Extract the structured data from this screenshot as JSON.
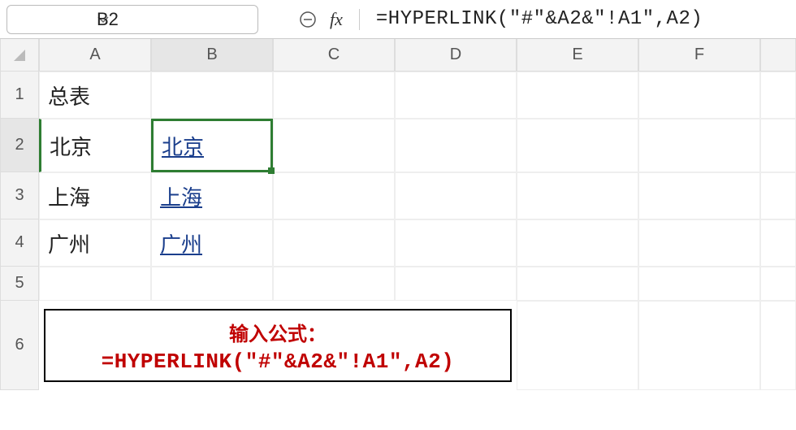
{
  "name_box": {
    "reference": "B2"
  },
  "formula_bar": {
    "formula": "=HYPERLINK(\"#\"&A2&\"!A1\",A2)"
  },
  "columns": [
    "A",
    "B",
    "C",
    "D",
    "E",
    "F"
  ],
  "rows": [
    "1",
    "2",
    "3",
    "4",
    "5",
    "6"
  ],
  "cells": {
    "A1": "总表",
    "A2": "北京",
    "A3": "上海",
    "A4": "广州",
    "B2": "北京",
    "B3": "上海",
    "B4": "广州"
  },
  "selection": {
    "active": "B2",
    "active_col": "B",
    "active_row": "2"
  },
  "annotation": {
    "line1": "输入公式：",
    "line2": "=HYPERLINK(″#″&A2&″!A1″,A2)"
  }
}
